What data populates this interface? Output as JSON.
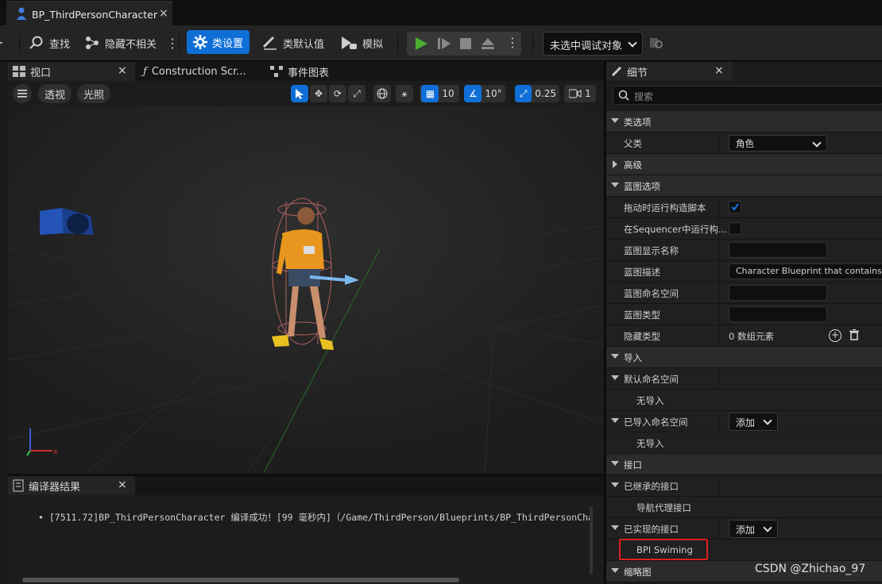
{
  "document_tab": {
    "title": "BP_ThirdPersonCharacter",
    "close": "×"
  },
  "toolbar": {
    "find": "查找",
    "hide_unrelated": "隐藏不相关",
    "class_settings": "类设置",
    "class_defaults": "类默认值",
    "simulate": "模拟",
    "debug_object": "未选中调试对象"
  },
  "tabs": {
    "viewport": "视口",
    "construction": "Construction Scr...",
    "event_graph": "事件图表",
    "details": "细节",
    "compiler": "编译器结果",
    "close": "×"
  },
  "viewport_toolbar": {
    "perspective": "透视",
    "lighting": "光照",
    "grid_value": "10",
    "angle_value": "10°",
    "scale_value": "0.25",
    "camera_speed": "1"
  },
  "compiler": {
    "message": "[7511.72]BP_ThirdPersonCharacter 编译成功！[99 毫秒内]（/Game/ThirdPerson/Blueprints/BP_ThirdPersonCha"
  },
  "details": {
    "search_placeholder": "搜索",
    "rows": [
      {
        "kind": "cat",
        "label": "类选项",
        "expanded": true
      },
      {
        "kind": "prop",
        "label": "父类",
        "value": "角色",
        "widget": "combo"
      },
      {
        "kind": "cat",
        "label": "高级",
        "expanded": false
      },
      {
        "kind": "cat",
        "label": "蓝图选项",
        "expanded": true
      },
      {
        "kind": "prop",
        "label": "拖动时运行构造脚本",
        "widget": "check",
        "checked": true
      },
      {
        "kind": "prop",
        "label": "在Sequencer中运行构...",
        "widget": "check",
        "checked": false
      },
      {
        "kind": "prop",
        "label": "蓝图显示名称",
        "widget": "text",
        "value": ""
      },
      {
        "kind": "prop",
        "label": "蓝图描述",
        "widget": "text",
        "value": "Character Blueprint that contains mo"
      },
      {
        "kind": "prop",
        "label": "蓝图命名空间",
        "widget": "text",
        "value": ""
      },
      {
        "kind": "prop",
        "label": "蓝图类型",
        "widget": "text",
        "value": ""
      },
      {
        "kind": "prop",
        "label": "隐藏类型",
        "widget": "array",
        "value": "0 数组元素"
      },
      {
        "kind": "cat",
        "label": "导入",
        "expanded": true
      },
      {
        "kind": "sub",
        "label": "默认命名空间",
        "expanded": true
      },
      {
        "kind": "leaf",
        "label": "无导入"
      },
      {
        "kind": "sub",
        "label": "已导入命名空间",
        "expanded": true,
        "widget": "add",
        "value": "添加"
      },
      {
        "kind": "leaf",
        "label": "无导入"
      },
      {
        "kind": "cat",
        "label": "接口",
        "expanded": true
      },
      {
        "kind": "sub",
        "label": "已继承的接口",
        "expanded": true
      },
      {
        "kind": "leaf",
        "label": "导航代理接口"
      },
      {
        "kind": "sub",
        "label": "已实现的接口",
        "expanded": true,
        "widget": "add",
        "value": "添加"
      },
      {
        "kind": "leaf",
        "label": "BPI Swiming",
        "highlight": true
      },
      {
        "kind": "cat",
        "label": "缩略图",
        "expanded": true
      }
    ]
  },
  "watermark": "CSDN @Zhichao_97",
  "colors": {
    "accent": "#0f6fd6",
    "highlight_box": "#e02020",
    "play_green": "#4caf30"
  }
}
